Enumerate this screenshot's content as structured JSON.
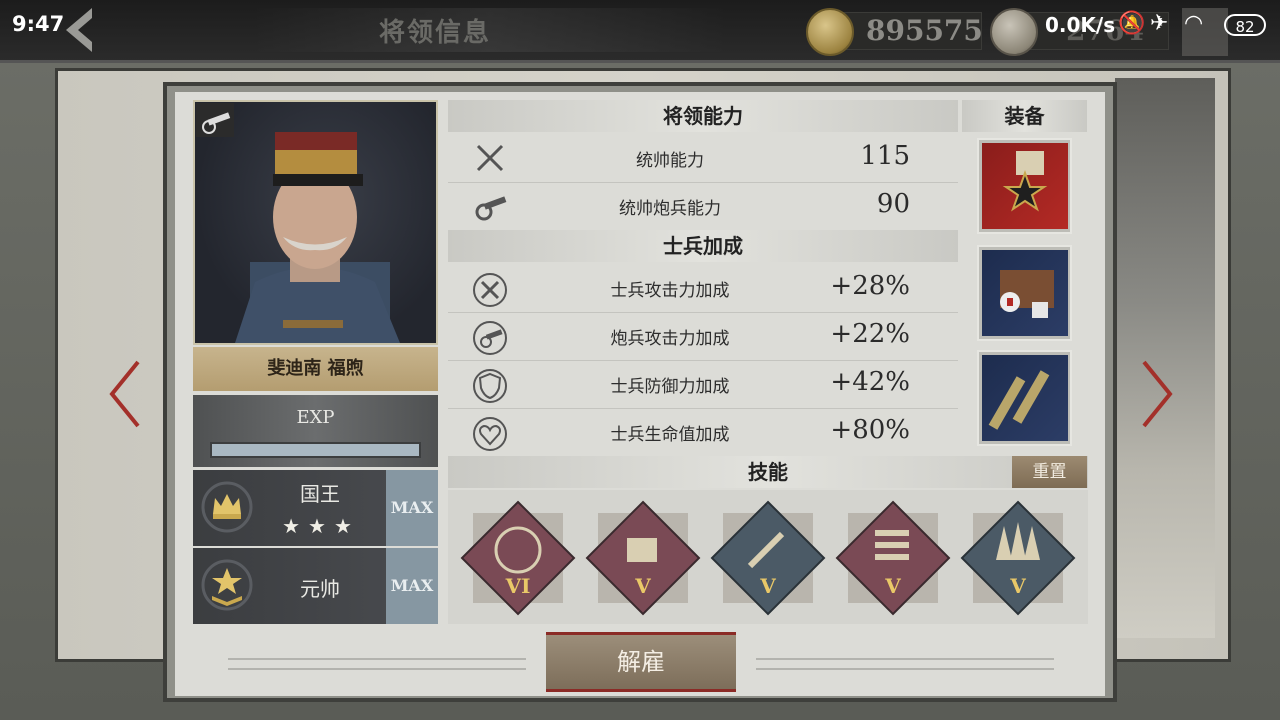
{
  "status_bar": {
    "time": "9:47",
    "net_speed": "0.0K/s",
    "battery": "82"
  },
  "header": {
    "title": "将领信息",
    "gold": "895575",
    "silver": "2764"
  },
  "general": {
    "name": "斐迪南 福煦",
    "exp_label": "EXP",
    "exp_fill": 1.0
  },
  "ranks": [
    {
      "title": "国王",
      "stars": "★★★",
      "max_label": "MAX",
      "icon": "crown-icon"
    },
    {
      "title": "元帅",
      "max_label": "MAX",
      "icon": "marshal-insignia-icon"
    }
  ],
  "sections": {
    "ability": "将领能力",
    "equipment": "装备",
    "soldier_bonus": "士兵加成",
    "skills": "技能"
  },
  "abilities": [
    {
      "label": "统帅能力",
      "value": "115",
      "icon": "crossed-swords-icon"
    },
    {
      "label": "统帅炮兵能力",
      "value": "90",
      "icon": "cannon-icon"
    }
  ],
  "bonuses": [
    {
      "label": "士兵攻击力加成",
      "value": "+28%",
      "icon": "sword-plus-icon"
    },
    {
      "label": "炮兵攻击力加成",
      "value": "+22%",
      "icon": "cannon-plus-icon"
    },
    {
      "label": "士兵防御力加成",
      "value": "+42%",
      "icon": "shield-plus-icon"
    },
    {
      "label": "士兵生命值加成",
      "value": "+80%",
      "icon": "heart-plus-icon"
    }
  ],
  "equipment": [
    {
      "name": "medal-icon"
    },
    {
      "name": "medical-kit-icon"
    },
    {
      "name": "binoculars-icon"
    }
  ],
  "reset_label": "重置",
  "skills": [
    {
      "level": "VI",
      "icon": "cannon-wreath-icon",
      "color": "#7a4a55"
    },
    {
      "level": "V",
      "icon": "fortification-icon",
      "color": "#7a4a55"
    },
    {
      "level": "V",
      "icon": "tools-icon",
      "color": "#4b5a66"
    },
    {
      "level": "V",
      "icon": "shells-icon",
      "color": "#7a4a55"
    },
    {
      "level": "V",
      "icon": "forest-icon",
      "color": "#4b5a66"
    }
  ],
  "dismiss_label": "解雇",
  "colors": {
    "accent_red": "#8b2b26",
    "gold_text": "#e9c868",
    "max_bg": "#8697a2"
  }
}
